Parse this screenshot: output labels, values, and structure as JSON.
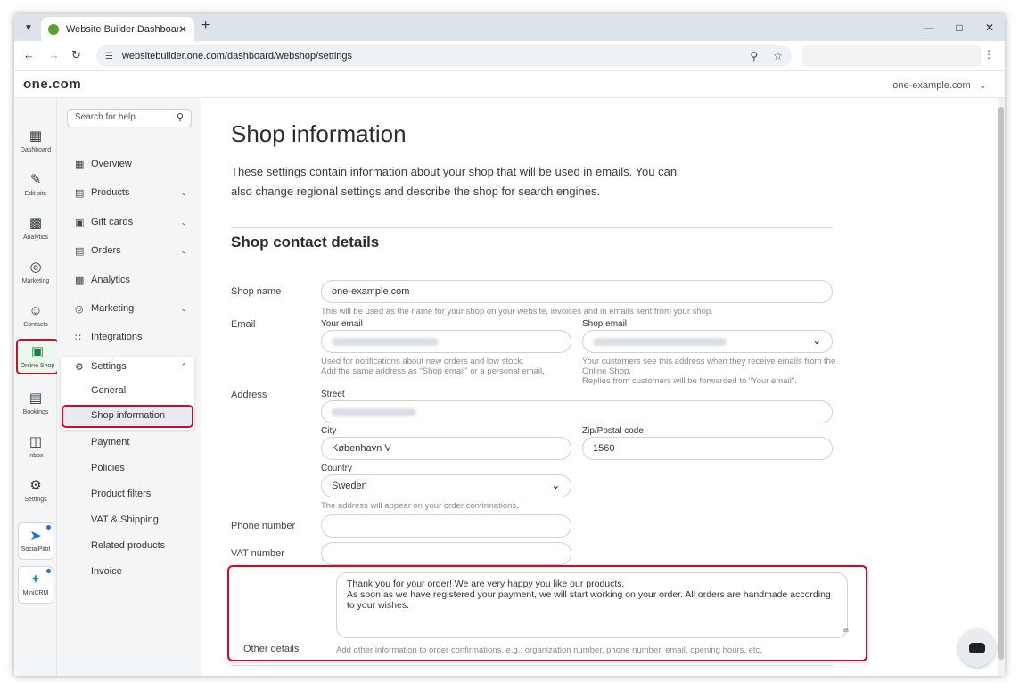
{
  "browser": {
    "tab_title": "Website Builder Dashboard",
    "url": "websitebuilder.one.com/dashboard/webshop/settings"
  },
  "header": {
    "logo": "one.com",
    "domain": "one-example.com"
  },
  "rail": [
    {
      "label": "Dashboard",
      "icon": "dashboard-icon"
    },
    {
      "label": "Edit site",
      "icon": "edit-icon"
    },
    {
      "label": "Analytics",
      "icon": "analytics-icon"
    },
    {
      "label": "Marketing",
      "icon": "target-icon"
    },
    {
      "label": "Contacts",
      "icon": "contacts-icon"
    },
    {
      "label": "Online Shop",
      "icon": "store-icon",
      "active": true
    },
    {
      "label": "Bookings",
      "icon": "calendar-icon"
    },
    {
      "label": "Inbox",
      "icon": "inbox-icon"
    },
    {
      "label": "Settings",
      "icon": "gear-icon"
    }
  ],
  "rail_apps": [
    {
      "label": "SocialPilot",
      "icon": "socialpilot-icon"
    },
    {
      "label": "MiniCRM",
      "icon": "minicrm-icon"
    }
  ],
  "sidebar": {
    "search_placeholder": "Search for help...",
    "items": [
      {
        "label": "Overview"
      },
      {
        "label": "Products"
      },
      {
        "label": "Gift cards"
      },
      {
        "label": "Orders"
      },
      {
        "label": "Analytics"
      },
      {
        "label": "Marketing"
      },
      {
        "label": "Integrations"
      },
      {
        "label": "Settings"
      }
    ],
    "settings_sub": [
      "General",
      "Shop information",
      "Payment",
      "Policies",
      "Product filters",
      "VAT & Shipping",
      "Related products",
      "Invoice"
    ]
  },
  "main": {
    "title": "Shop information",
    "intro": "These settings contain information about your shop that will be used in emails. You can also change regional settings and describe the shop for search engines.",
    "section_title": "Shop contact details",
    "shop_name_label": "Shop name",
    "shop_name_value": "one-example.com",
    "shop_name_help": "This will be used as the name for your shop on your website, invoices and in emails sent from your shop.",
    "email_label": "Email",
    "your_email_label": "Your email",
    "your_email_help": "Used for notifications about new orders and low stock.\nAdd the same address as \"Shop email\" or a personal email.",
    "shop_email_label": "Shop email",
    "shop_email_help": "Your customers see this address when they receive emails from the Online Shop.\nReplies from customers will be forwarded to \"Your email\".",
    "address_label": "Address",
    "street_label": "Street",
    "city_label": "City",
    "city_value": "København V",
    "zip_label": "Zip/Postal code",
    "zip_value": "1560",
    "country_label": "Country",
    "country_value": "Sweden",
    "address_help": "The address will appear on your order confirmations.",
    "phone_label": "Phone number",
    "vat_label": "VAT number",
    "other_label": "Other details",
    "other_value": "Thank you for your order! We are very happy you like our products.\nAs soon as we have registered your payment, we will start working on your order. All orders are handmade according to your wishes.",
    "other_help": "Add other information to order confirmations. e.g.: organization number, phone number, email, opening hours, etc."
  },
  "colors": {
    "highlight": "#c8102e",
    "active_green": "#1a7f3c"
  }
}
